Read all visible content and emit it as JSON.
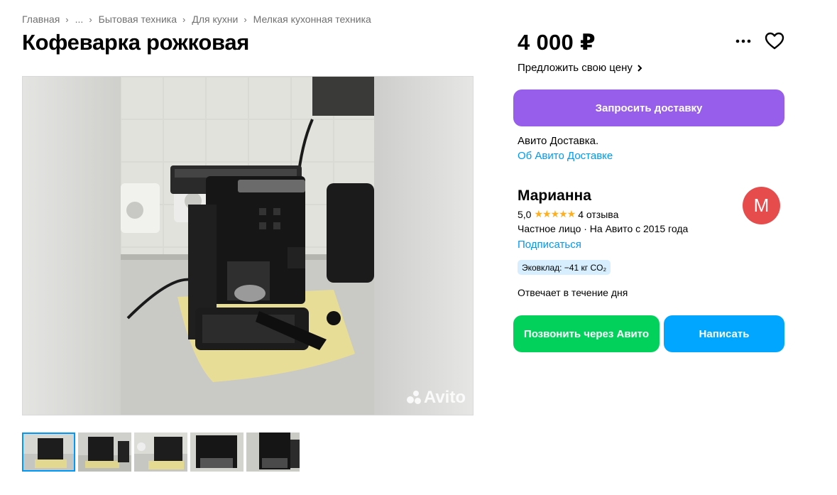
{
  "breadcrumbs": {
    "items": [
      "Главная",
      "...",
      "Бытовая техника",
      "Для кухни",
      "Мелкая кухонная техника"
    ]
  },
  "listing": {
    "title": "Кофеварка рожковая",
    "price": "4 000 ₽",
    "offer_price": "Предложить свою цену",
    "watermark": "Avito",
    "photo_count": 5,
    "active_photo": 1
  },
  "actions": {
    "more_icon": "more-horizontal-icon",
    "favorite_icon": "heart-outline-icon"
  },
  "delivery": {
    "button": "Запросить доставку",
    "text": "Авито Доставка.",
    "link": "Об Авито Доставке"
  },
  "seller": {
    "name": "Марианна",
    "rating": "5,0",
    "stars": "★★★★★",
    "star_rating": 5,
    "reviews": "4 отзыва",
    "info": "Частное лицо · На Авито с 2015 года",
    "subscribe": "Подписаться",
    "eco": "Эковклад: −41 кг CO₂",
    "avatar_letter": "М",
    "response": "Отвечает в течение дня"
  },
  "contact": {
    "call": "Позвонить через Авито",
    "write": "Написать"
  },
  "colors": {
    "delivery_button": "#965eeb",
    "call_button": "#02d15c",
    "write_button": "#00a6ff",
    "link": "#0099f7",
    "avatar": "#e64c4c",
    "star": "#ffb021"
  }
}
